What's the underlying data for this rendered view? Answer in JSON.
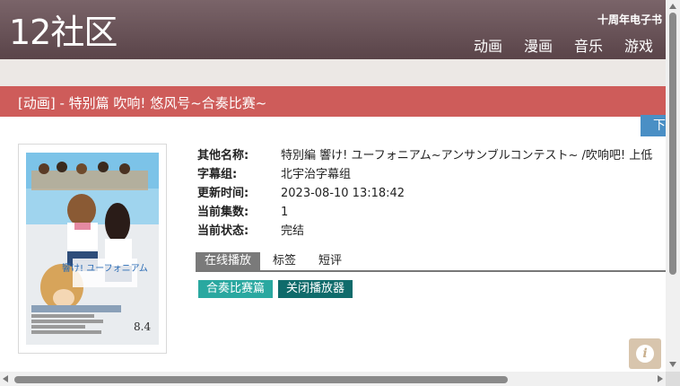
{
  "site": {
    "logo": "12社区",
    "promo": "十周年电子书",
    "nav": [
      "动画",
      "漫画",
      "音乐",
      "游戏"
    ]
  },
  "page": {
    "title": "[动画] - 特别篇 吹响! 悠风号~合奏比赛~",
    "download_label": "下"
  },
  "info": [
    {
      "key": "其他名称:",
      "value": "特別編 響け! ユーフォニアム~アンサンブルコンテスト~ /吹响吧! 上低"
    },
    {
      "key": "字幕组:",
      "value": "北宇治字幕组"
    },
    {
      "key": "更新时间:",
      "value": "2023-08-10 13:18:42"
    },
    {
      "key": "当前集数:",
      "value": "1"
    },
    {
      "key": "当前状态:",
      "value": "完结"
    }
  ],
  "tabs": [
    "在线播放",
    "标签",
    "短评"
  ],
  "episodes": [
    {
      "label": "合奏比赛篇",
      "color": "#2aa8a0"
    },
    {
      "label": "关闭播放器",
      "color": "#0f6b6b"
    }
  ],
  "poster": {
    "title_text": "響け! ユーフォニアム",
    "date_text": "8.4",
    "sky_color": "#7cc3e8"
  }
}
